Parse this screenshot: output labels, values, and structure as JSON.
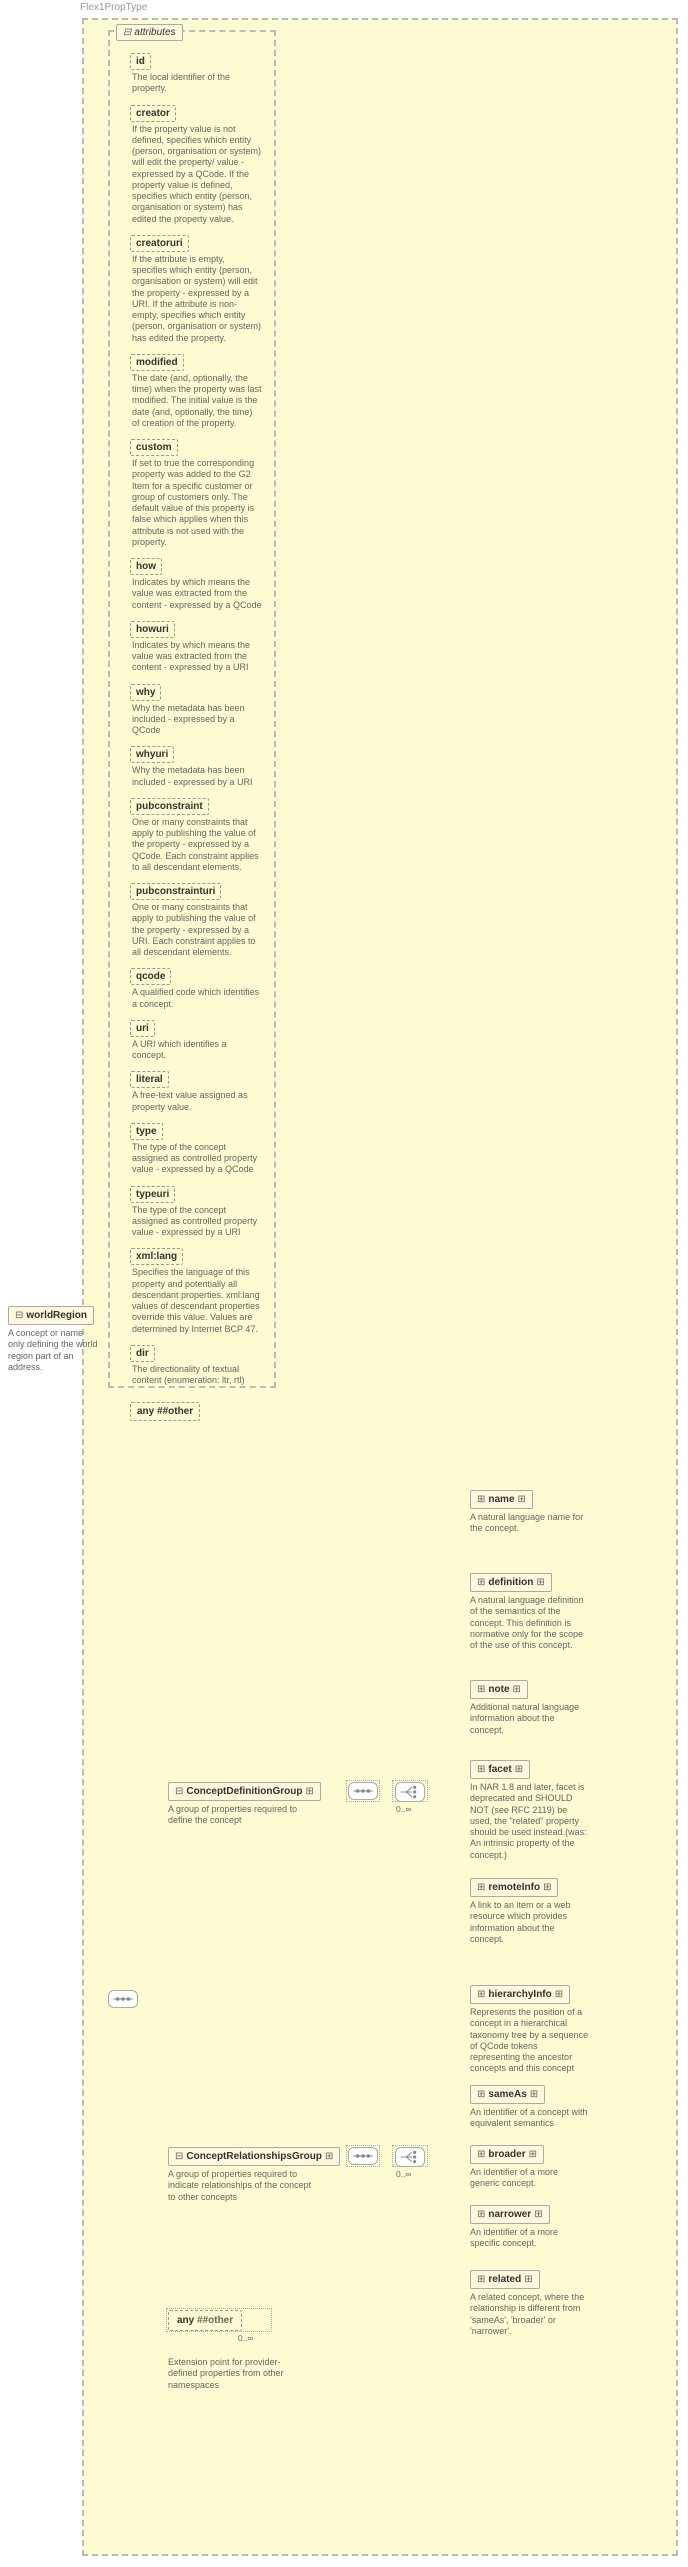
{
  "heading": "Flex1PropType",
  "root": {
    "label": "worldRegion",
    "desc": "A concept or name only defining the world region part of an address."
  },
  "attributesLabel": "attributes",
  "attrs": [
    {
      "name": "id",
      "desc": "The local identifier of the property."
    },
    {
      "name": "creator",
      "desc": "If the property value is not defined, specifies which entity (person, organisation or system) will edit the property/ value - expressed by a QCode. If the property value is defined, specifies which entity (person, organisation or system) has edited the property value."
    },
    {
      "name": "creatoruri",
      "desc": "If the attribute is empty, specifies which entity (person, organisation or system) will edit the property - expressed by a URI. If the attribute is non-empty, specifies which entity (person, organisation or system) has edited the property."
    },
    {
      "name": "modified",
      "desc": "The date (and, optionally, the time) when the property was last modified. The initial value is the date (and, optionally, the time) of creation of the property."
    },
    {
      "name": "custom",
      "desc": "If set to true the corresponding property was added to the G2 Item for a specific customer or group of customers only. The default value of this property is false which applies when this attribute is not used with the property."
    },
    {
      "name": "how",
      "desc": "Indicates by which means the value was extracted from the content - expressed by a QCode"
    },
    {
      "name": "howuri",
      "desc": "Indicates by which means the value was extracted from the content - expressed by a URI"
    },
    {
      "name": "why",
      "desc": "Why the metadata has been included - expressed by a QCode"
    },
    {
      "name": "whyuri",
      "desc": "Why the metadata has been included - expressed by a URI"
    },
    {
      "name": "pubconstraint",
      "desc": "One or many constraints that apply to publishing the value of the property - expressed by a QCode. Each constraint applies to all descendant elements."
    },
    {
      "name": "pubconstrainturi",
      "desc": "One or many constraints that apply to publishing the value of the property - expressed by a URI. Each constraint applies to all descendant elements."
    },
    {
      "name": "qcode",
      "desc": "A qualified code which identifies a concept."
    },
    {
      "name": "uri",
      "desc": "A URI which identifies a concept."
    },
    {
      "name": "literal",
      "desc": "A free-text value assigned as property value."
    },
    {
      "name": "type",
      "desc": "The type of the concept assigned as controlled property value - expressed by a QCode"
    },
    {
      "name": "typeuri",
      "desc": "The type of the concept assigned as controlled property value - expressed by a URI"
    },
    {
      "name": "xml:lang",
      "desc": "Specifies the language of this property and potentially all descendant properties. xml:lang values of descendant properties override this value. Values are determined by Internet BCP 47."
    },
    {
      "name": "dir",
      "desc": "The directionality of textual content (enumeration: ltr, rtl)"
    }
  ],
  "attrAnyLabel": "any ##other",
  "groups": {
    "conceptDef": {
      "label": "ConceptDefinitionGroup",
      "desc": "A group of properties required to define the concept",
      "card": "0..∞"
    },
    "conceptRel": {
      "label": "ConceptRelationshipsGroup",
      "desc": "A group of properties required to indicate relationships of the concept to other concepts",
      "card": "0..∞"
    },
    "anyOther": {
      "label": "any ##other",
      "desc": "Extension point for provider-defined properties from other namespaces",
      "card": "0..∞"
    }
  },
  "defChildren": [
    {
      "name": "name",
      "desc": "A natural language name for the concept."
    },
    {
      "name": "definition",
      "desc": "A natural language definition of the semantics of the concept. This definition is normative only for the scope of the use of this concept."
    },
    {
      "name": "note",
      "desc": "Additional natural language information about the concept."
    },
    {
      "name": "facet",
      "desc": "In NAR 1.8 and later, facet is deprecated and SHOULD NOT (see RFC 2119) be used, the \"related\" property should be used instead.(was: An intrinsic property of the concept.)"
    },
    {
      "name": "remoteInfo",
      "desc": "A link to an item or a web resource which provides information about the concept."
    },
    {
      "name": "hierarchyInfo",
      "desc": "Represents the position of a concept in a hierarchical taxonomy tree by a sequence of QCode tokens representing the ancestor concepts and this concept"
    }
  ],
  "relChildren": [
    {
      "name": "sameAs",
      "desc": "An identifier of a concept with equivalent semantics"
    },
    {
      "name": "broader",
      "desc": "An identifier of a more generic concept."
    },
    {
      "name": "narrower",
      "desc": "An identifier of a more specific concept."
    },
    {
      "name": "related",
      "desc": "A related concept, where the relationship is different from 'sameAs', 'broader' or 'narrower'."
    }
  ]
}
